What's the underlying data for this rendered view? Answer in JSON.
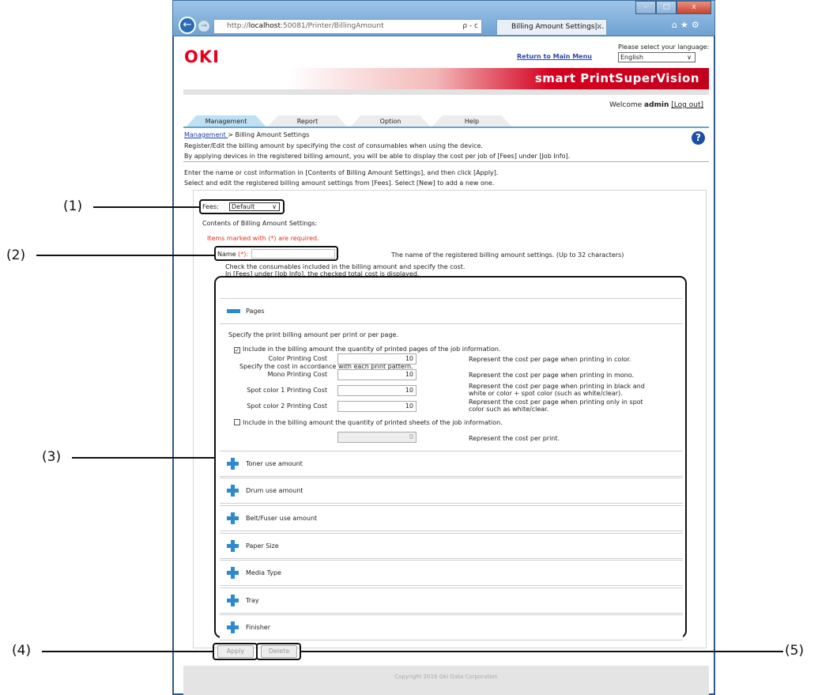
{
  "browser": {
    "window_controls": [
      "–",
      "□",
      "x"
    ],
    "address_prefix": "http://",
    "address_host": "localhost",
    "address_path": ":50081/Printer/BillingAmount",
    "address_controls": "ρ - c",
    "tab_title": "Billing Amount Settings|...",
    "tab_close": "×",
    "toolbar_icons": "⌂★⚙"
  },
  "header": {
    "logo": "OKI",
    "return_link": "Return to Main Menu",
    "language_label": "Please select your language:",
    "language_value": "English",
    "brand": "smart PrintSuperVision",
    "welcome_prefix": "Welcome",
    "user": "admin",
    "logout": "[Log out]"
  },
  "tabs": [
    "Management",
    "Report",
    "Option",
    "Help"
  ],
  "breadcrumb": {
    "link": "Management ",
    "current": "> Billing Amount Settings"
  },
  "intro": [
    "Register/Edit the billing amount by specifying the cost of consumables when using the device.",
    "By applying devices in the registered billing amount, you will be able to display the cost per job of [Fees] under [Job Info]."
  ],
  "instructions": [
    "Enter the name or cost information in [Contents of Billing Amount Settings], and then click [Apply].",
    "Select and edit the registered billing amount settings from [Fees]. Select [New] to add a new one."
  ],
  "form": {
    "fees_label": "Fees:",
    "fees_value": "Default",
    "contents_heading": "Contents of Billing Amount Settings:",
    "required_note": "Items marked with (*) are required.",
    "name_label": "Name",
    "name_req": "(*):",
    "name_value": "",
    "name_hint": "The name of the registered billing amount settings. (Up to 32 characters)",
    "consumables_hint_1": "Check the consumables included in the billing amount and specify the cost.",
    "consumables_hint_2": "In [Fees] under [Job Info], the checked total cost is displayed."
  },
  "pages_section": {
    "title": "Pages",
    "description": "Specify the print billing amount per print or per page.",
    "check_pages_label": "Include in the billing amount the quantity of printed pages of the job information.",
    "check_pages_checked": true,
    "pattern_hint": "Specify the cost in accordance with each print pattern.",
    "costs": [
      {
        "label": "Color Printing Cost",
        "value": "10",
        "desc": "Represent the cost per page when printing in color."
      },
      {
        "label": "Mono Printing Cost",
        "value": "10",
        "desc": "Represent the cost per page when printing in mono."
      },
      {
        "label": "Spot color 1 Printing Cost",
        "value": "10",
        "desc": "Represent the cost per page when printing in black and white or color + spot color (such as white/clear)."
      },
      {
        "label": "Spot color 2 Printing Cost",
        "value": "10",
        "desc": "Represent the cost per page when printing only in spot color such as white/clear."
      }
    ],
    "check_sheets_label": "Include in the billing amount the quantity of printed sheets of the job information.",
    "check_sheets_checked": false,
    "print_cost_value": "0",
    "print_cost_desc": "Represent the cost per print."
  },
  "collapsed_sections": [
    "Toner use amount",
    "Drum use amount",
    "Belt/Fuser use amount",
    "Paper Size",
    "Media Type",
    "Tray",
    "Finisher"
  ],
  "buttons": {
    "apply": "Apply",
    "delete": "Delete"
  },
  "footer": "Copyright 2016 Oki Data Corporation",
  "callouts": [
    "(1)",
    "(2)",
    "(3)",
    "(4)",
    "(5)"
  ],
  "colors": {
    "brand_red": "#e8001d",
    "accent_blue": "#2d8ad0",
    "tab_active": "#bfdff2"
  }
}
